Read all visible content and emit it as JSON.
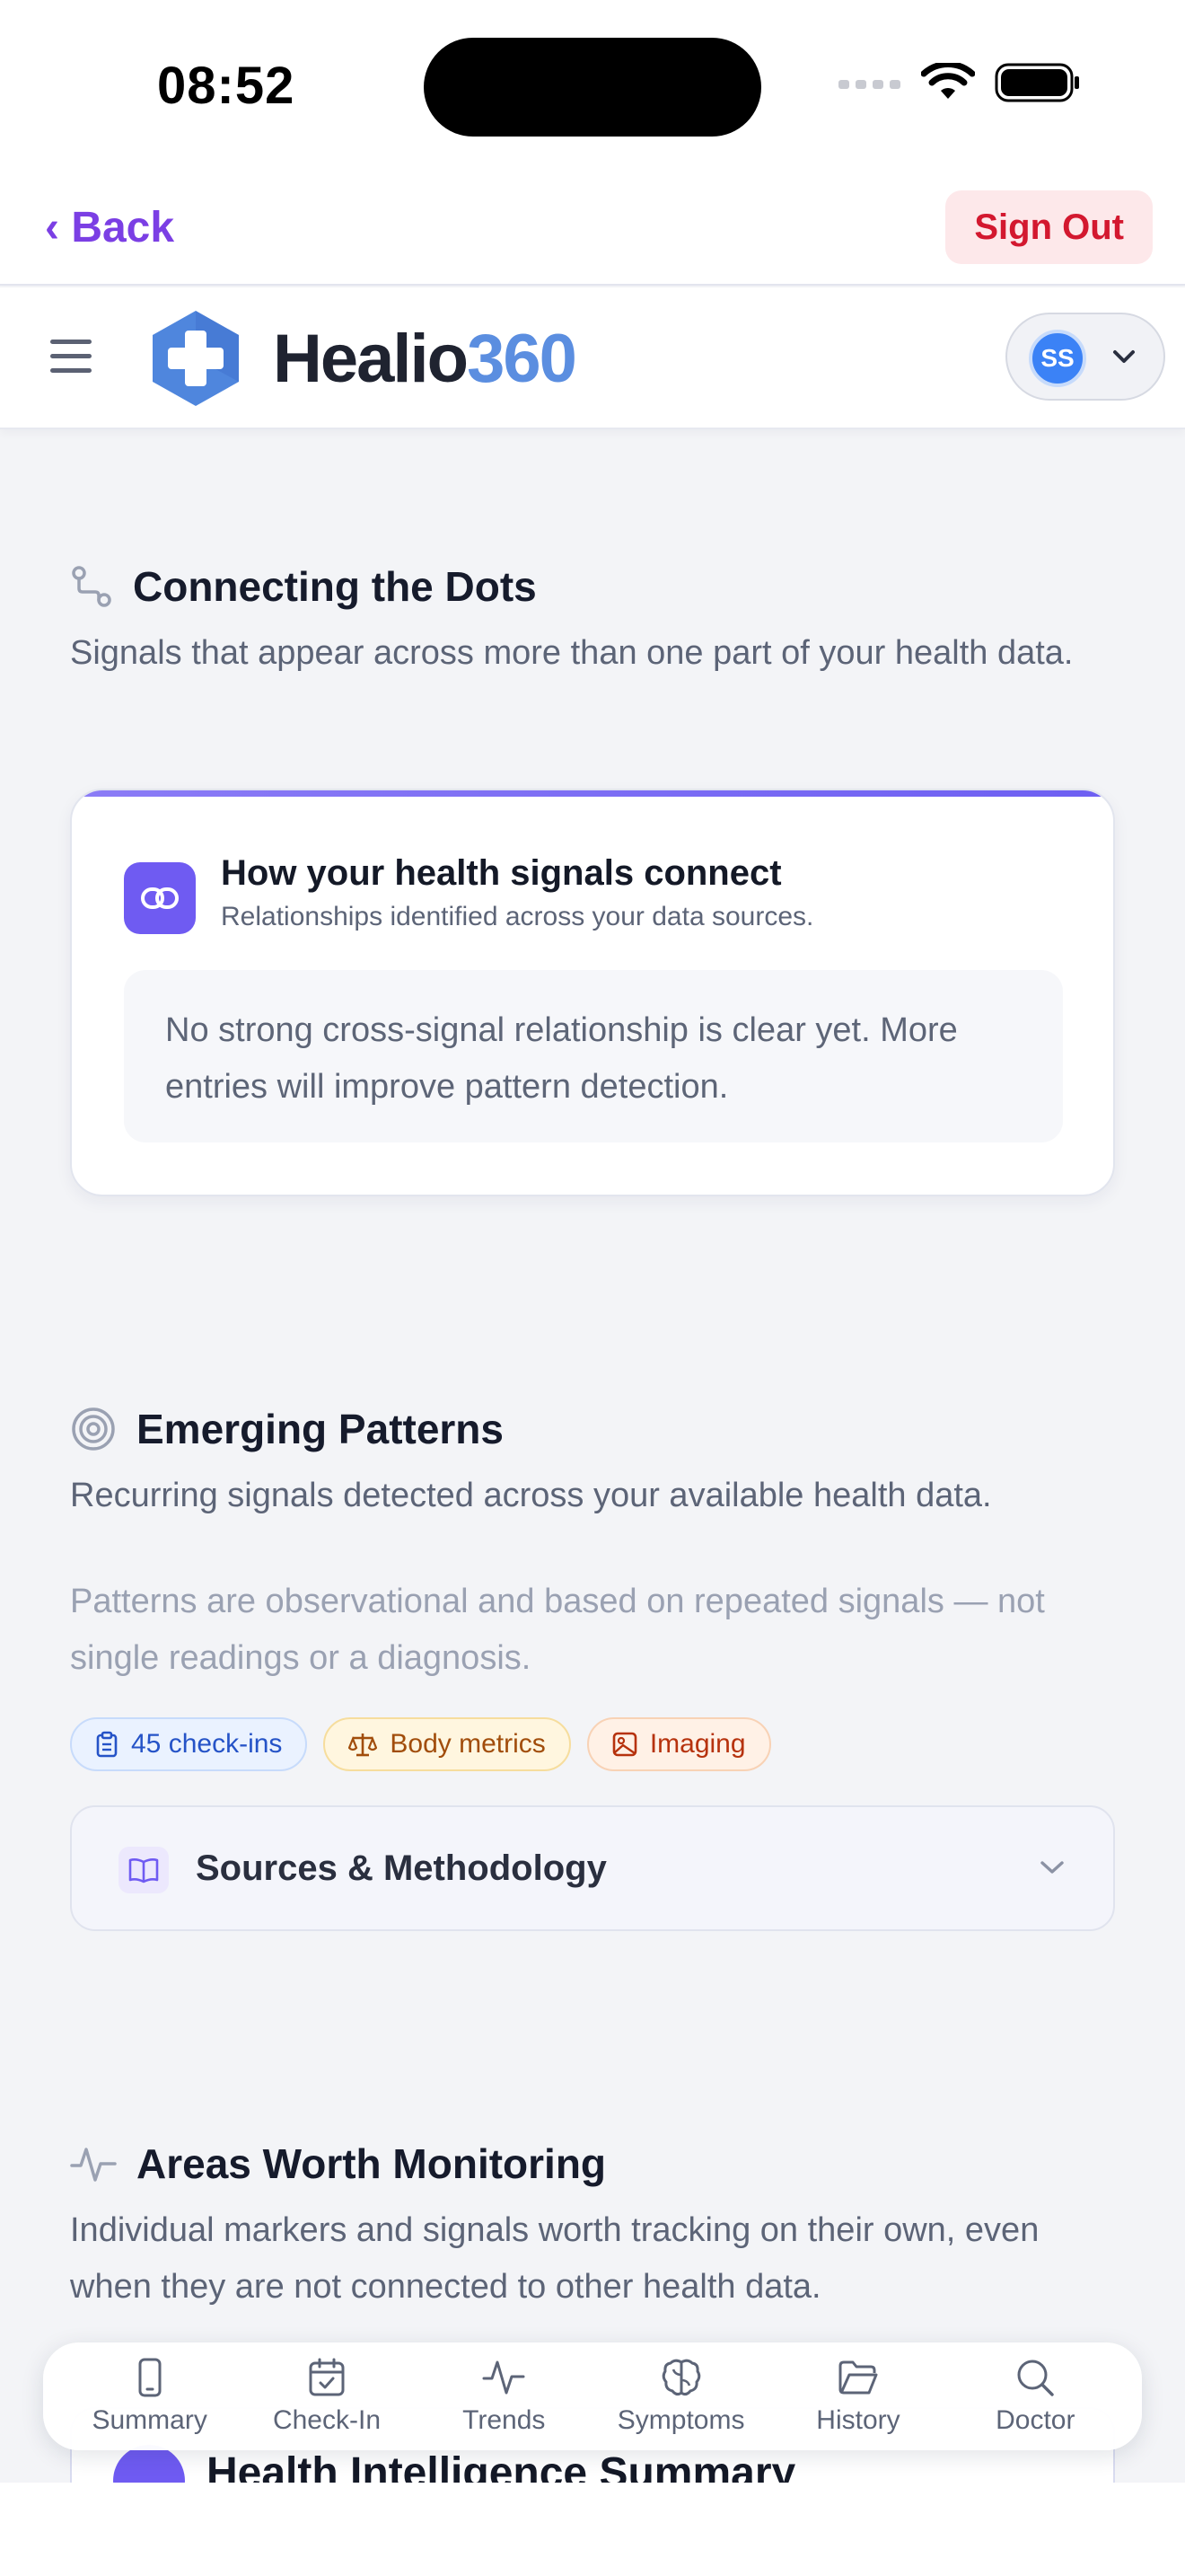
{
  "status_bar": {
    "time": "08:52"
  },
  "nav_bar": {
    "back_label": "‹ Back",
    "signout_label": "Sign Out"
  },
  "header": {
    "brand_part1": "Healio",
    "brand_part2": "360",
    "user_initials": "SS"
  },
  "connecting": {
    "title": "Connecting the Dots",
    "subtitle": "Signals that appear across more than one part of your health data.",
    "card": {
      "title": "How your health signals connect",
      "subtitle": "Relationships identified across your data sources.",
      "empty_text": "No strong cross-signal relationship is clear yet. More entries will improve pattern detection."
    }
  },
  "emerging": {
    "title": "Emerging Patterns",
    "subtitle": "Recurring signals detected across your available health data.",
    "note": "Patterns are observational and based on repeated signals — not single readings or a diagnosis.",
    "chips": [
      {
        "label": "45 check-ins",
        "icon": "clipboard-icon",
        "color": "#2553c7"
      },
      {
        "label": "Body metrics",
        "icon": "scale-icon",
        "color": "#a14d0b"
      },
      {
        "label": "Imaging",
        "icon": "image-icon",
        "color": "#b6320d"
      }
    ],
    "accordion_label": "Sources & Methodology"
  },
  "monitoring": {
    "title": "Areas Worth Monitoring",
    "subtitle": "Individual markers and signals worth tracking on their own, even when they are not connected to other health data.",
    "next_card_title": "Health Intelligence Summary"
  },
  "bottom_nav": [
    {
      "label": "Summary",
      "icon": "phone-icon"
    },
    {
      "label": "Check-In",
      "icon": "calendar-check-icon"
    },
    {
      "label": "Trends",
      "icon": "pulse-icon"
    },
    {
      "label": "Symptoms",
      "icon": "brain-icon"
    },
    {
      "label": "History",
      "icon": "folder-icon"
    },
    {
      "label": "Doctor",
      "icon": "search-icon"
    }
  ],
  "colors": {
    "accent": "#7b3fe4",
    "brand_blue": "#5b8ee0",
    "danger": "#d3182f",
    "badge_purple": "#6f5bf2"
  }
}
